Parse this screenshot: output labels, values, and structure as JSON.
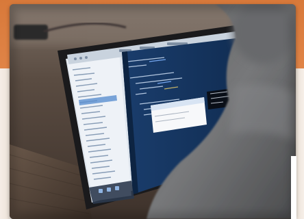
{
  "photo": {
    "subject": "person-using-laptop-with-code-editor"
  },
  "colors": {
    "frame_accent": "#e08447",
    "frame_background": "#f3ede6",
    "editor_background": "#14345c",
    "sidebar_background": "#e9eef5"
  }
}
